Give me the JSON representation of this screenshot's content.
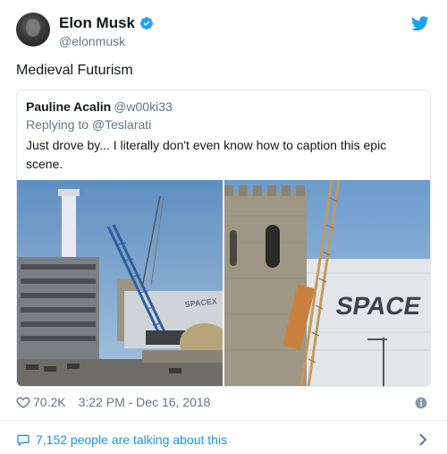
{
  "author": {
    "name": "Elon Musk",
    "handle": "@elonmusk",
    "verified_icon": "verified-badge-icon",
    "platform_icon": "twitter-bird-icon"
  },
  "tweet": {
    "text": "Medieval Futurism"
  },
  "quoted": {
    "name": "Pauline Acalin",
    "handle": "@w00ki33",
    "replying_to": "Replying to @Teslarati",
    "text": "Just drove by... I literally don't even know how to caption this epic scene.",
    "photos": [
      {
        "description": "construction-crane-tower-photo",
        "sign_text": "SPACEX"
      },
      {
        "description": "stone-tower-spacex-building-photo",
        "sign_text": "SPACE"
      }
    ]
  },
  "stats": {
    "likes": "70.2K",
    "timestamp": "3:22 PM - Dec 16, 2018"
  },
  "footer": {
    "talking": "7,152 people are talking about this"
  },
  "colors": {
    "accent": "#1da1f2",
    "link": "#1b95e0",
    "secondary_text": "#657786",
    "border": "#e1e8ed"
  }
}
